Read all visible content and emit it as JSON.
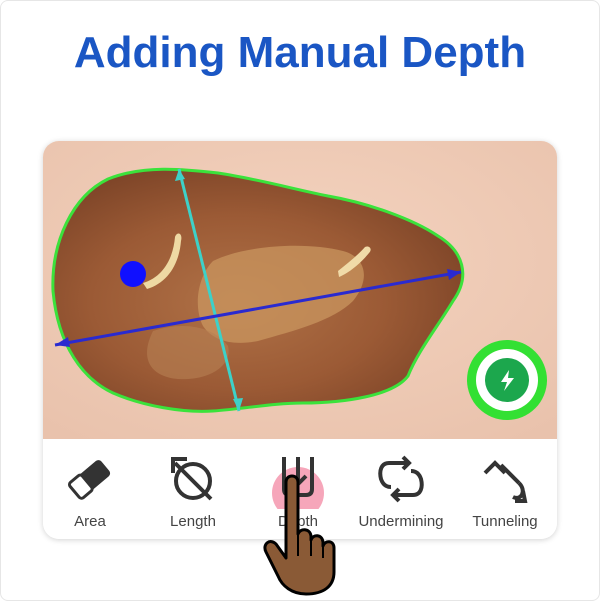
{
  "title": "Adding Manual Depth",
  "colors": {
    "title": "#1a56c4",
    "outline": "#3be23b",
    "length_line": "#3dd1c8",
    "width_line": "#2a2ad0",
    "marker": "#1010ff",
    "fab_ring": "#33e033",
    "fab_center": "#1ca74d",
    "highlight": "#f06b8c"
  },
  "fab": {
    "icon": "lightning-icon"
  },
  "toolbar": {
    "items": [
      {
        "label": "Area",
        "icon": "eraser-icon"
      },
      {
        "label": "Length",
        "icon": "length-icon"
      },
      {
        "label": "Depth",
        "icon": "depth-icon"
      },
      {
        "label": "Undermining",
        "icon": "undermining-icon"
      },
      {
        "label": "Tunneling",
        "icon": "tunneling-icon"
      }
    ],
    "selected": "Depth"
  }
}
